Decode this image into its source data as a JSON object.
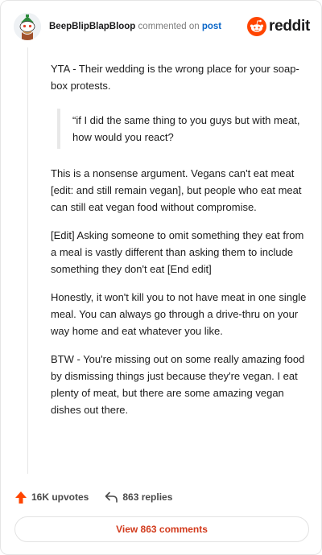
{
  "header": {
    "username": "BeepBlipBlapBloop",
    "action_text": "commented on",
    "post_link": "post",
    "logo_text": "reddit"
  },
  "comment": {
    "para1": "YTA - Their wedding is the wrong place for your soap-box protests.",
    "quote": "“if I did the same thing to you guys but with meat, how would you react?",
    "para2": "This is a nonsense argument. Vegans can't eat meat [edit: and still remain vegan], but people who eat meat can still eat vegan food without compromise.",
    "para3": "[Edit] Asking someone to omit something they eat from a meal is vastly different than asking them to include something they don't eat [End edit]",
    "para4": "Honestly, it won't kill you to not have meat in one single meal. You can always go through a drive-thru on your way home and eat whatever you like.",
    "para5": "BTW - You're missing out on some really amazing food by dismissing things just because they're vegan. I eat plenty of meat, but there are some amazing vegan dishes out there."
  },
  "actions": {
    "upvotes": "16K upvotes",
    "replies": "863 replies"
  },
  "footer": {
    "view_comments": "View 863 comments"
  },
  "icons": {
    "avatar": "snoo-avatar-icon",
    "logo": "reddit-logo-icon",
    "upvote": "upvote-arrow-icon",
    "reply": "reply-arrow-icon"
  },
  "colors": {
    "accent": "#ff4500",
    "link": "#0a66c8",
    "button_text": "#d23a1c"
  }
}
